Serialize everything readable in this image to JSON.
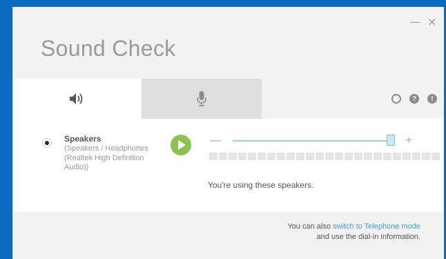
{
  "window": {
    "title": "Sound Check",
    "minimize_label": "—",
    "close_label": "×"
  },
  "tabs": [
    {
      "name": "speakers",
      "icon": "speaker-icon",
      "active": true
    },
    {
      "name": "microphone",
      "icon": "microphone-icon",
      "active": false
    }
  ],
  "tools": [
    {
      "icon": "settings-icon",
      "glyph": ""
    },
    {
      "icon": "help-icon",
      "glyph": "?"
    },
    {
      "icon": "info-icon",
      "glyph": "!"
    }
  ],
  "device": {
    "name": "Speakers",
    "description": "(Speakers / Headphones (Realtek High Definition Audio))",
    "selected": true
  },
  "volume": {
    "minus_label": "—",
    "plus_label": "+",
    "level": 0.98,
    "meter_segments": 24,
    "meter_active": 0
  },
  "status": "You're using these speakers.",
  "footer": {
    "prefix": "You can also ",
    "link": "switch to Telephone mode",
    "line2": "and use the dial-in information."
  },
  "colors": {
    "background": "#0a6cc0",
    "play_button": "#8cc34f",
    "accent": "#3aa0d8"
  }
}
